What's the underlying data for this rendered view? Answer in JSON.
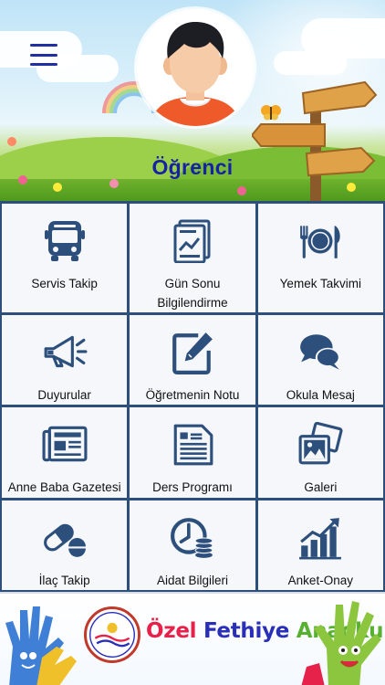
{
  "header": {
    "title": "Öğrenci",
    "menu_icon": "hamburger-menu-icon",
    "avatar_icon": "student-avatar-icon"
  },
  "tiles": [
    {
      "label": "Servis Takip",
      "icon": "bus-icon"
    },
    {
      "label": "Gün Sonu Bilgilendirme",
      "icon": "report-chart-icon"
    },
    {
      "label": "Yemek Takvimi",
      "icon": "cutlery-plate-icon"
    },
    {
      "label": "Duyurular",
      "icon": "megaphone-icon"
    },
    {
      "label": "Öğretmenin Notu",
      "icon": "edit-note-icon"
    },
    {
      "label": "Okula Mesaj",
      "icon": "chat-bubbles-icon"
    },
    {
      "label": "Anne Baba Gazetesi",
      "icon": "newspaper-icon"
    },
    {
      "label": "Ders Programı",
      "icon": "document-list-icon"
    },
    {
      "label": "Galeri",
      "icon": "photo-gallery-icon"
    },
    {
      "label": "İlaç Takip",
      "icon": "pill-icon"
    },
    {
      "label": "Aidat Bilgileri",
      "icon": "clock-coins-icon"
    },
    {
      "label": "Anket-Onay",
      "icon": "bar-chart-growth-icon"
    }
  ],
  "footer": {
    "school_word1": "Özel",
    "school_word2": "Fethiye",
    "school_word3": "Anaokulu"
  },
  "colors": {
    "icon": "#2c4f7c",
    "grid_border": "#2c4f7c",
    "title": "#1522a6",
    "tile_bg": "#f6f7fa"
  }
}
